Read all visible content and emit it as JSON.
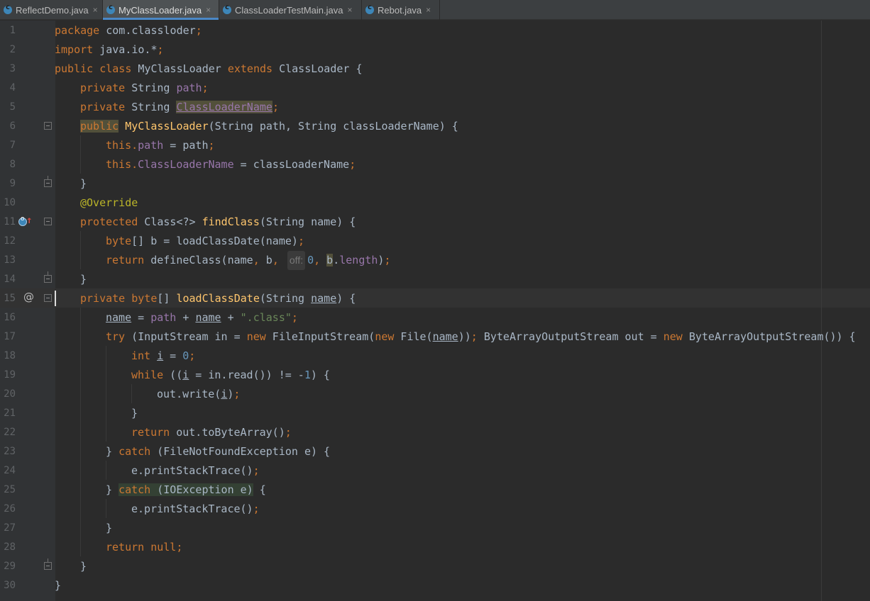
{
  "tabs": [
    {
      "label": "ReflectDemo.java",
      "icon": "java-class-icon",
      "active": false
    },
    {
      "label": "MyClassLoader.java",
      "icon": "java-class-icon",
      "active": true
    },
    {
      "label": "ClassLoaderTestMain.java",
      "icon": "java-class-icon",
      "active": false
    },
    {
      "label": "Rebot.java",
      "icon": "java-class-icon",
      "active": false
    }
  ],
  "tab_close_symbol": "×",
  "line_numbers": [
    "1",
    "2",
    "3",
    "4",
    "5",
    "6",
    "7",
    "8",
    "9",
    "10",
    "11",
    "12",
    "13",
    "14",
    "15",
    "16",
    "17",
    "18",
    "19",
    "20",
    "21",
    "22",
    "23",
    "24",
    "25",
    "26",
    "27",
    "28",
    "29",
    "30"
  ],
  "current_line": 15,
  "gutter_icons": {
    "line_11": [
      "override-method-icon",
      "overridden-arrow-icon"
    ],
    "line_15": "at-bookmark-icon"
  },
  "code": {
    "l1": [
      "package",
      " com.classloder",
      ";"
    ],
    "l2": [
      "import",
      " java.io.*",
      ";"
    ],
    "l3": [
      "public class",
      " MyClassLoader ",
      "extends",
      " ClassLoader {"
    ],
    "l4": [
      "private",
      " String ",
      "path",
      ";"
    ],
    "l5": [
      "private",
      " String ",
      "ClassLoaderName",
      ";"
    ],
    "l6": [
      "public",
      " ",
      "MyClassLoader",
      "(String path, String classLoaderName) {"
    ],
    "l7": [
      "this",
      ".",
      "path",
      " = path",
      ";"
    ],
    "l8": [
      "this",
      ".",
      "ClassLoaderName",
      " = classLoaderName",
      ";"
    ],
    "l9": [
      "}"
    ],
    "l10": [
      "@Override"
    ],
    "l11": [
      "protected",
      " Class<?> ",
      "findClass",
      "(String name) {"
    ],
    "l12": [
      "byte",
      "[] b = loadClassDate(name)",
      ";"
    ],
    "l13": [
      "return",
      " defineClass(name",
      ", ",
      "b",
      ", ",
      "off:",
      "0",
      ", ",
      "b",
      ".",
      "length",
      ")",
      ";"
    ],
    "l14": [
      "}"
    ],
    "l15": [
      "private",
      " ",
      "byte",
      "[] ",
      "loadClassDate",
      "(String ",
      "name",
      ") {"
    ],
    "l16": [
      "name",
      " = ",
      "path",
      " + ",
      "name",
      " + ",
      "\".class\"",
      ";"
    ],
    "l17": [
      "try",
      " (InputStream in = ",
      "new",
      " FileInputStream(",
      "new",
      " File(",
      "name",
      "))",
      ";",
      " ByteArrayOutputStream out = ",
      "new",
      " ByteArrayOutputStream()) {"
    ],
    "l18": [
      "int",
      " ",
      "i",
      " = ",
      "0",
      ";"
    ],
    "l19": [
      "while",
      " ((",
      "i",
      " = in.read()) != -",
      "1",
      ") {"
    ],
    "l20": [
      "out.write(",
      "i",
      ")",
      ";"
    ],
    "l21": [
      "}"
    ],
    "l22": [
      "return",
      " out.toByteArray()",
      ";"
    ],
    "l23": [
      "} ",
      "catch",
      " (FileNotFoundException e) {"
    ],
    "l24": [
      "e.printStackTrace()",
      ";"
    ],
    "l25": [
      "} ",
      "catch",
      " (IOException e)",
      " {"
    ],
    "l26": [
      "e.printStackTrace()",
      ";"
    ],
    "l27": [
      "}"
    ],
    "l28": [
      "return",
      " ",
      "null",
      ";"
    ],
    "l29": [
      "}"
    ],
    "l30": [
      "}"
    ]
  }
}
